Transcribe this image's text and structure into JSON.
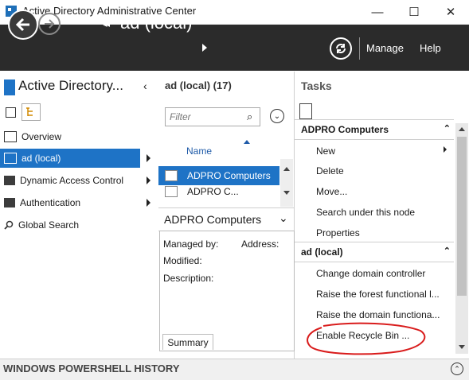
{
  "window": {
    "title": "Active Directory Administrative Center",
    "minimize_glyph": "—",
    "maximize_glyph": "☐",
    "close_glyph": "✕"
  },
  "navbar": {
    "breadcrumb_prefix": "◂◂",
    "breadcrumb": "ad (local)",
    "manage_label": "Manage",
    "help_label": "Help"
  },
  "left_pane": {
    "title": "Active Directory...",
    "collapse_glyph": "‹",
    "items": [
      {
        "label": "Overview",
        "icon": "overview-icon"
      },
      {
        "label": "ad (local)",
        "icon": "domain-icon"
      },
      {
        "label": "Dynamic Access Control",
        "icon": "folder-icon"
      },
      {
        "label": "Authentication",
        "icon": "folder-icon"
      },
      {
        "label": "Global Search",
        "icon": "search-icon"
      }
    ]
  },
  "middle_pane": {
    "title": "ad (local)  (17)",
    "filter_placeholder": "Filter",
    "filter_icon_glyph": "⌕",
    "expand_glyph": "⌄",
    "column_header": "Name",
    "rows": [
      "ADPRO Computers",
      "ADPRO C..."
    ],
    "details": {
      "title": "ADPRO Computers",
      "chevron_glyph": "⌄",
      "managed_by_label": "Managed by:",
      "address_label": "Address:",
      "modified_label": "Modified:",
      "description_label": "Description:",
      "tab_label": "Summary"
    }
  },
  "tasks_pane": {
    "title": "Tasks",
    "sections": [
      {
        "label": "ADPRO Computers",
        "items": [
          "New",
          "Delete",
          "Move...",
          "Search under this node",
          "Properties"
        ]
      },
      {
        "label": "ad (local)",
        "items": [
          "Change domain controller",
          "Raise the forest functional l...",
          "Raise the domain functiona...",
          "Enable Recycle Bin ..."
        ]
      }
    ],
    "collapse_glyph": "⌃"
  },
  "bottom_bar": {
    "label": "WINDOWS POWERSHELL HISTORY",
    "expand_glyph": "⌃"
  },
  "colors": {
    "nav_background": "#2b2b2b",
    "selection": "#1e73c6",
    "annotation": "#d91c1c"
  }
}
